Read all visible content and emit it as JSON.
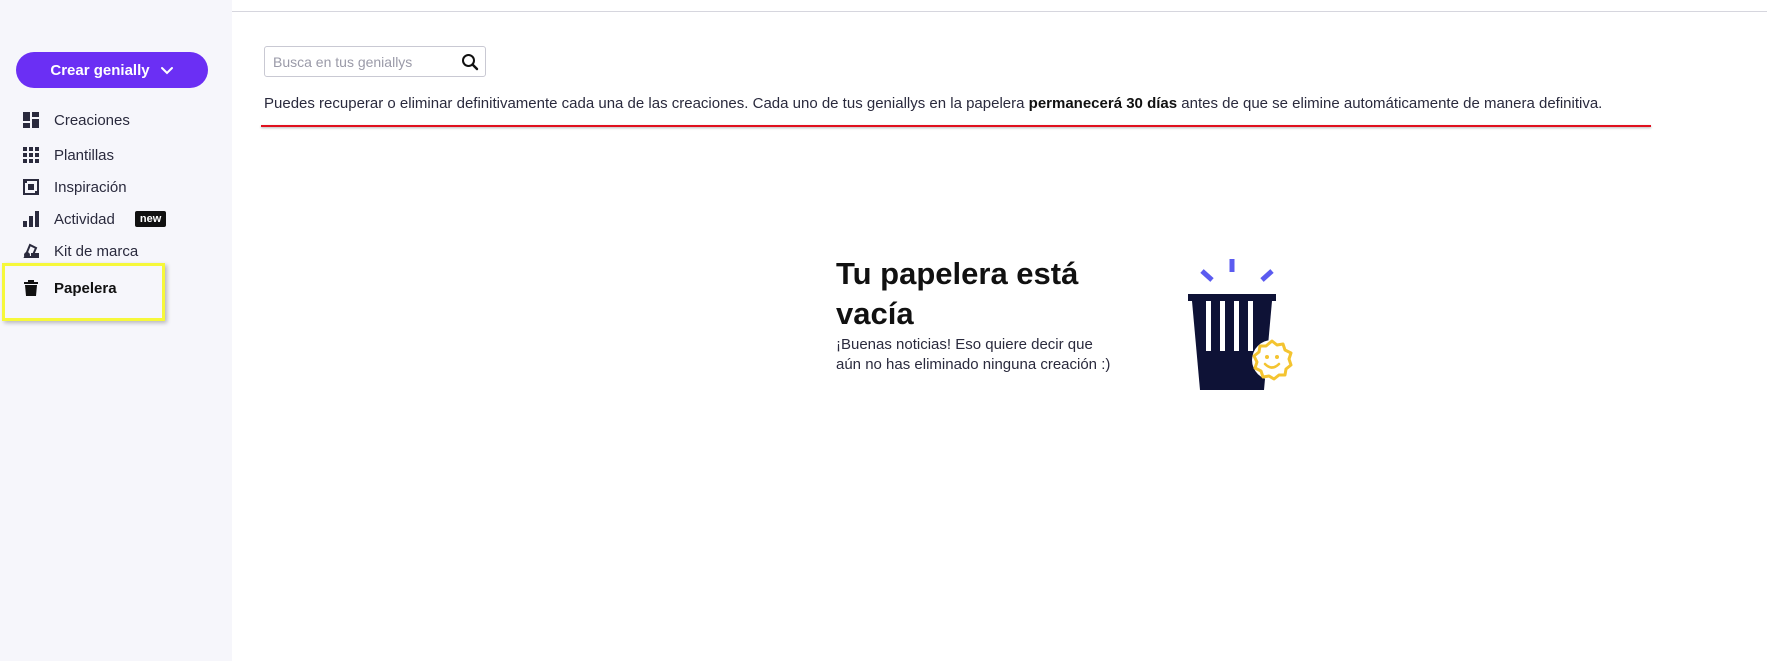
{
  "sidebar": {
    "create_button_label": "Crear genially",
    "items": [
      {
        "label": "Creaciones",
        "icon": "dashboard-icon"
      },
      {
        "label": "Plantillas",
        "icon": "grid-icon"
      },
      {
        "label": "Inspiración",
        "icon": "inspiration-icon"
      },
      {
        "label": "Actividad",
        "icon": "bar-chart-icon",
        "badge": "new"
      },
      {
        "label": "Kit de marca",
        "icon": "brand-kit-icon"
      },
      {
        "label": "Papelera",
        "icon": "trash-icon",
        "active": true
      }
    ]
  },
  "search": {
    "placeholder": "Busca en tus geniallys"
  },
  "info": {
    "text_before": "Puedes recuperar o eliminar definitivamente cada una de las creaciones. Cada uno de tus geniallys en la papelera ",
    "text_bold": "permanecerá 30 días",
    "text_after": " antes de que se elimine automáticamente de manera definitiva."
  },
  "empty_state": {
    "title": "Tu papelera está vacía",
    "subtitle": "¡Buenas noticias! Eso quiere decir que aún no has eliminado ninguna creación :)"
  },
  "colors": {
    "brand": "#6b2ff4",
    "sidebar_bg": "#f6f6fb",
    "highlight": "#f6f83a",
    "underline": "#e0101e",
    "illustration_dark": "#0e1236",
    "illustration_accent": "#5b5bf0",
    "illustration_smile": "#f4c430"
  }
}
